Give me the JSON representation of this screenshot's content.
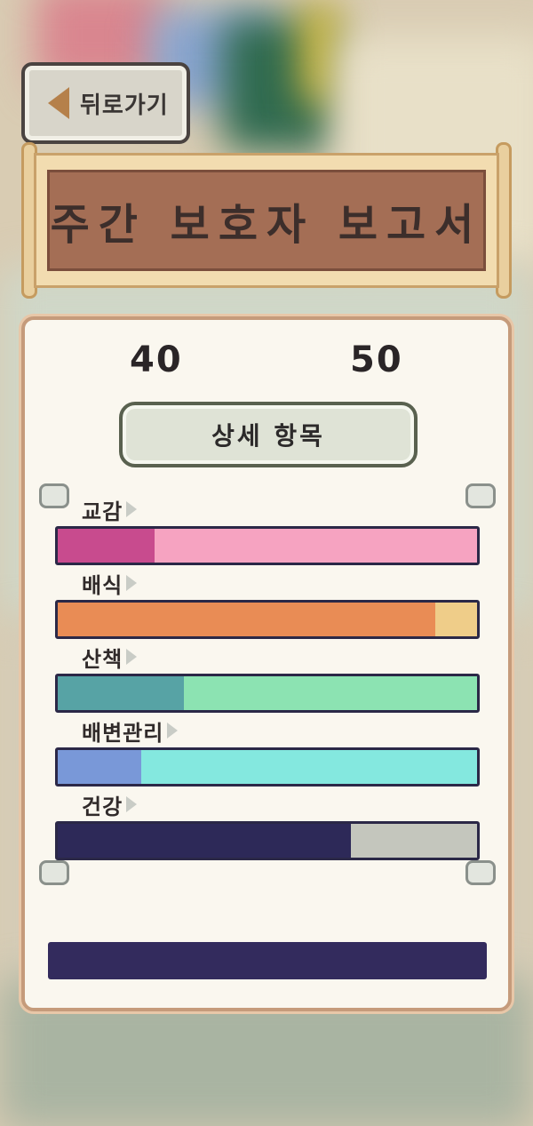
{
  "back_button": {
    "label": "뒤로가기"
  },
  "title": "주간 보호자 보고서",
  "ages": {
    "left": "40",
    "right": "50"
  },
  "detail_button": {
    "label": "상세 항목"
  },
  "stats": [
    {
      "label": "교감",
      "value": 0.23,
      "fill_color": "#c84b8e",
      "track_color": "#f6a3c1"
    },
    {
      "label": "배식",
      "value": 0.9,
      "fill_color": "#e98c55",
      "track_color": "#efcd89"
    },
    {
      "label": "산책",
      "value": 0.3,
      "fill_color": "#57a3a5",
      "track_color": "#8ce3b2"
    },
    {
      "label": "배변관리",
      "value": 0.2,
      "fill_color": "#7998d8",
      "track_color": "#84e8df"
    },
    {
      "label": "건강",
      "value": 0.7,
      "fill_color": "#2d2958",
      "track_color": "#c4c6bd"
    }
  ],
  "colors": {
    "title_bg": "#a46e55",
    "panel_bg": "#faf7ef",
    "bottom_bar": "#332b5d"
  }
}
